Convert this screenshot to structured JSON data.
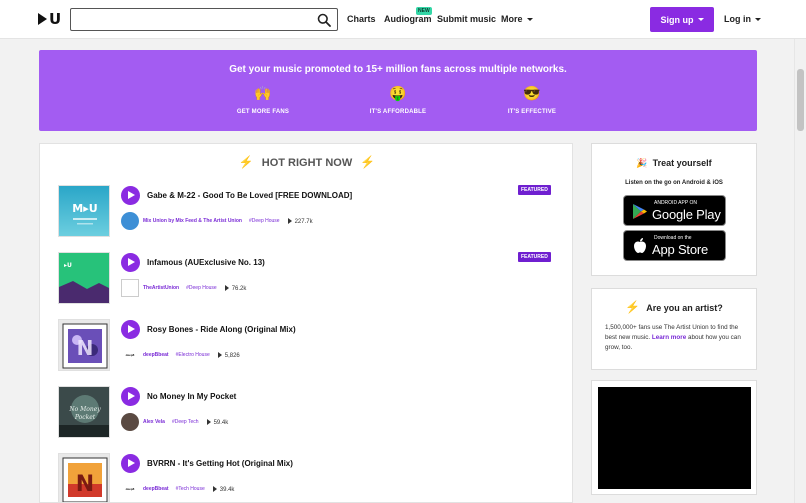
{
  "header": {
    "logo_letter": "U",
    "search": {
      "value": "",
      "placeholder": ""
    },
    "nav": [
      {
        "label": "Charts"
      },
      {
        "label": "Audiogram",
        "badge": "NEW"
      },
      {
        "label": "Submit music"
      },
      {
        "label": "More"
      }
    ],
    "signup_label": "Sign up",
    "login_label": "Log in"
  },
  "promo": {
    "title": "Get your music promoted to 15+ million fans across multiple networks.",
    "items": [
      {
        "icon": "raised-hands-emoji",
        "emoji": "🙌",
        "label": "GET MORE FANS"
      },
      {
        "icon": "money-mouth-emoji",
        "emoji": "🤑",
        "label": "IT'S AFFORDABLE"
      },
      {
        "icon": "sunglasses-emoji",
        "emoji": "😎",
        "label": "IT'S EFFECTIVE"
      }
    ]
  },
  "hot": {
    "heading": "HOT RIGHT NOW",
    "featured_label": "FEATURED",
    "tracks": [
      {
        "title": "Gabe & M-22 - Good To Be Loved [FREE DOWNLOAD]",
        "uploader": "Mix Union by Mix Feed & The Artist Union",
        "tag": "#Deep House",
        "plays": "227.7k",
        "featured": true
      },
      {
        "title": "Infamous (AUExclusive No. 13)",
        "uploader": "TheArtistUnion",
        "tag": "#Deep House",
        "plays": "76.2k",
        "featured": true
      },
      {
        "title": "Rosy Bones - Ride Along (Original Mix)",
        "uploader": "deepBbeat",
        "tag": "#Electro House",
        "plays": "5,826",
        "featured": false
      },
      {
        "title": "No Money In My Pocket",
        "uploader": "Alex Vela",
        "tag": "#Deep Tech",
        "plays": "59.4k",
        "featured": false
      },
      {
        "title": "BVRRN - It's Getting Hot (Original Mix)",
        "uploader": "deepBbeat",
        "tag": "#Tech House",
        "plays": "39.4k",
        "featured": false
      }
    ]
  },
  "treat": {
    "title": "Treat yourself",
    "subtitle": "Listen on the go on Android & iOS",
    "google": {
      "small": "ANDROID APP ON",
      "big": "Google Play"
    },
    "apple": {
      "small": "Download on the",
      "big": "App Store"
    }
  },
  "artist": {
    "title": "Are you an artist?",
    "text_before": "1,500,000+ fans use The Artist Union to find the best new music.",
    "link": "Learn more",
    "text_after": "about how you can grow, too."
  },
  "colors": {
    "accent": "#8a2be2",
    "promo_bg": "#a35cf2",
    "new_badge": "#33d6a6",
    "bolt": "#f4c63d"
  }
}
